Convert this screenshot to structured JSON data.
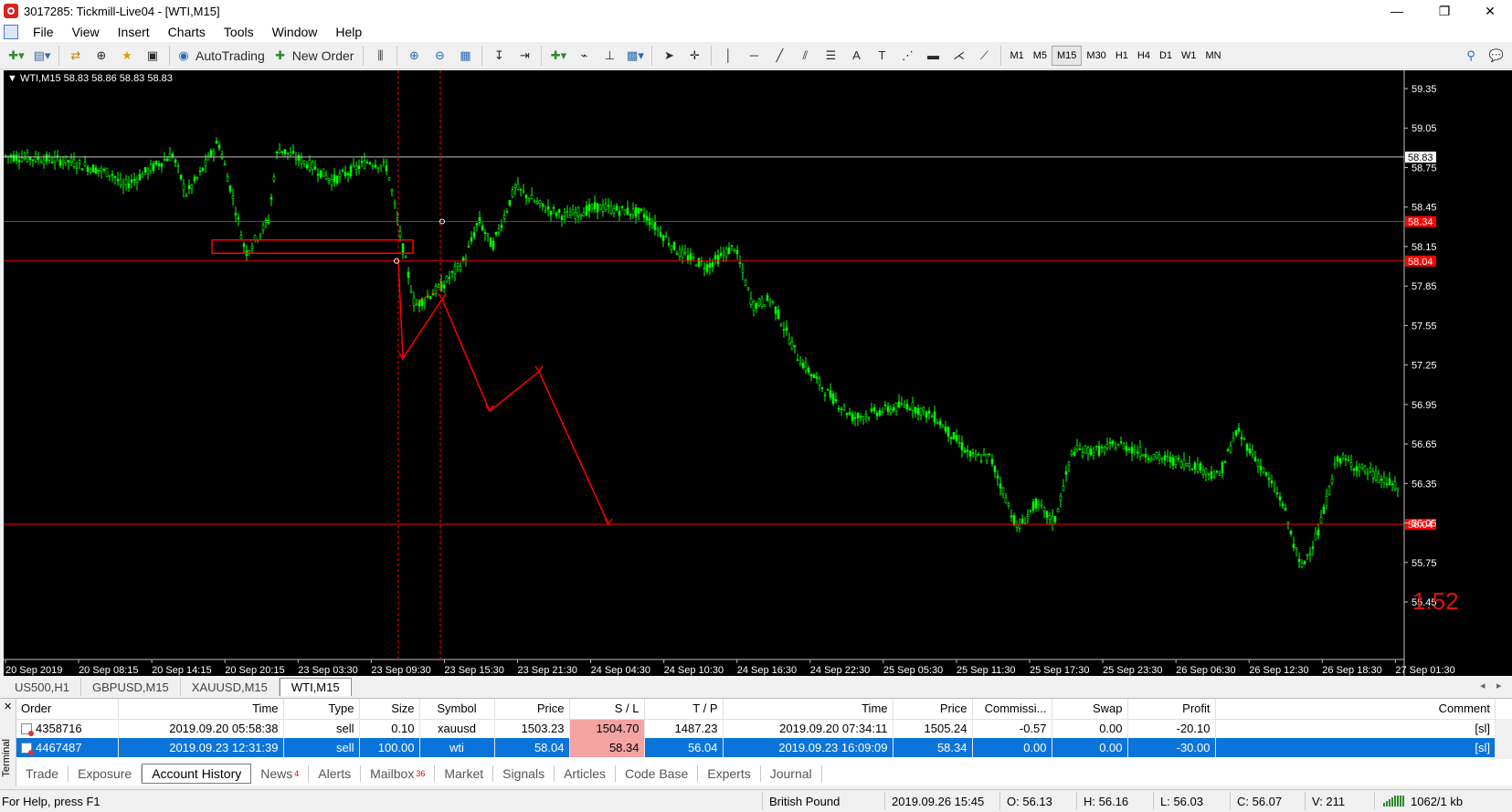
{
  "window": {
    "title": "3017285: Tickmill-Live04 - [WTI,M15]",
    "minimize": "—",
    "maximize": "❐",
    "close": "✕",
    "mdi_min": "–",
    "mdi_restore": "▫",
    "mdi_close": "×"
  },
  "menu": [
    "File",
    "View",
    "Insert",
    "Charts",
    "Tools",
    "Window",
    "Help"
  ],
  "toolbar": {
    "autotrading_label": "AutoTrading",
    "new_order_label": "New Order",
    "timeframes": [
      "M1",
      "M5",
      "M15",
      "M30",
      "H1",
      "H4",
      "D1",
      "W1",
      "MN"
    ],
    "active_timeframe": "M15"
  },
  "chart": {
    "info_line": "▼ WTI,M15  58.83 58.86 58.83 58.83",
    "big_value": "1.52",
    "colors": {
      "background": "#000000",
      "candle": "#00ff00",
      "line": "#ff0000",
      "current": "#c0c0c0"
    },
    "price_labels": [
      "59.35",
      "59.05",
      "58.75",
      "58.45",
      "58.15",
      "57.85",
      "57.55",
      "57.25",
      "56.95",
      "56.65",
      "56.35",
      "56.05",
      "55.75",
      "55.45"
    ],
    "current_price": "58.83",
    "level_labels": [
      "58.34",
      "58.04",
      "56.04"
    ],
    "time_labels": [
      "20 Sep 2019",
      "20 Sep 08:15",
      "20 Sep 14:15",
      "20 Sep 20:15",
      "23 Sep 03:30",
      "23 Sep 09:30",
      "23 Sep 15:30",
      "23 Sep 21:30",
      "24 Sep 04:30",
      "24 Sep 10:30",
      "24 Sep 16:30",
      "24 Sep 22:30",
      "25 Sep 05:30",
      "25 Sep 11:30",
      "25 Sep 17:30",
      "25 Sep 23:30",
      "26 Sep 06:30",
      "26 Sep 12:30",
      "26 Sep 18:30",
      "27 Sep 01:30"
    ]
  },
  "chart_tabs": [
    "US500,H1",
    "GBPUSD,M15",
    "XAUUSD,M15",
    "WTI,M15"
  ],
  "history": {
    "columns": [
      "Order",
      "Time",
      "Type",
      "Size",
      "Symbol",
      "Price",
      "S / L",
      "T / P",
      "Time",
      "Price",
      "Commissi...",
      "Swap",
      "Profit",
      "Comment"
    ],
    "rows": [
      [
        "4358716",
        "2019.09.20 05:58:38",
        "sell",
        "0.10",
        "xauusd",
        "1503.23",
        "1504.70",
        "1487.23",
        "2019.09.20 07:34:11",
        "1505.24",
        "-0.57",
        "0.00",
        "-20.10",
        "[sl]"
      ],
      [
        "4467487",
        "2019.09.23 12:31:39",
        "sell",
        "100.00",
        "wti",
        "58.04",
        "58.34",
        "56.04",
        "2019.09.23 16:09:09",
        "58.34",
        "0.00",
        "0.00",
        "-30.00",
        "[sl]"
      ]
    ]
  },
  "terminal": {
    "side_label": "Terminal",
    "tabs": [
      "Trade",
      "Exposure",
      "Account History",
      "News",
      "Alerts",
      "Mailbox",
      "Market",
      "Signals",
      "Articles",
      "Code Base",
      "Experts",
      "Journal"
    ],
    "news_count": "4",
    "mailbox_count": "36"
  },
  "status": {
    "help": "For Help, press F1",
    "profile": "British Pound",
    "datetime": "2019.09.26 15:45",
    "open": "O: 56.13",
    "high": "H: 56.16",
    "low": "L: 56.03",
    "close": "C: 56.07",
    "volume": "V: 211",
    "traffic": "1062/1 kb"
  }
}
